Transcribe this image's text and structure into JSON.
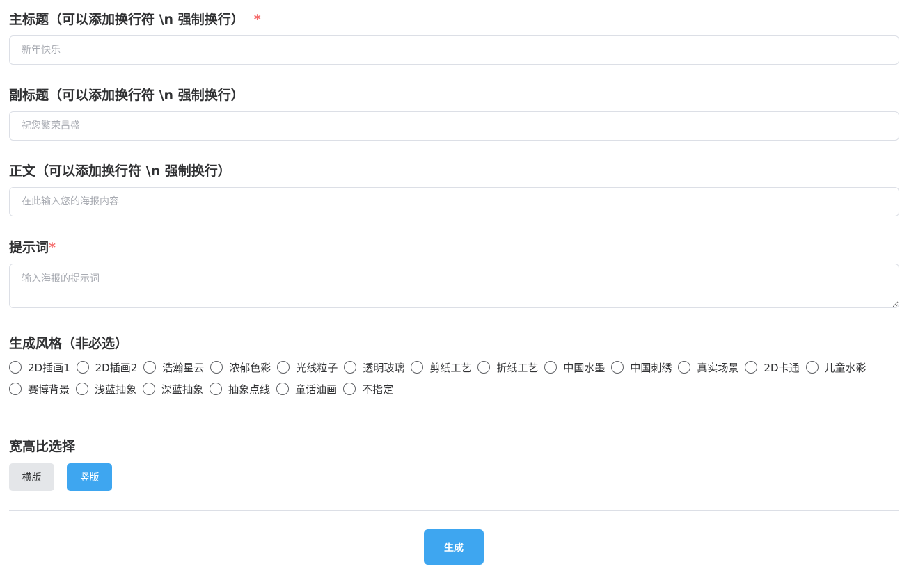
{
  "title_field": {
    "label": "主标题（可以添加换行符 \\n 强制换行）",
    "required_mark": "*",
    "placeholder": "新年快乐"
  },
  "subtitle_field": {
    "label": "副标题（可以添加换行符 \\n 强制换行）",
    "placeholder": "祝您繁荣昌盛"
  },
  "body_field": {
    "label": "正文（可以添加换行符 \\n 强制换行）",
    "placeholder": "在此输入您的海报内容"
  },
  "prompt_field": {
    "label": "提示词",
    "required_mark": "*",
    "placeholder": "输入海报的提示词"
  },
  "style_section": {
    "label": "生成风格（非必选）",
    "row1": [
      "2D插画1",
      "2D插画2",
      "浩瀚星云",
      "浓郁色彩",
      "光线粒子",
      "透明玻璃",
      "剪纸工艺",
      "折纸工艺",
      "中国水墨",
      "中国刺绣",
      "真实场景",
      "2D卡通",
      "儿童水彩"
    ],
    "row2": [
      "赛博背景",
      "浅蓝抽象",
      "深蓝抽象",
      "抽象点线",
      "童话油画",
      "不指定"
    ]
  },
  "ratio_section": {
    "label": "宽高比选择",
    "landscape_label": "横版",
    "portrait_label": "竖版",
    "selected": "竖版"
  },
  "generate_label": "生成",
  "colors": {
    "accent": "#3ea6f0",
    "required": "#f56c6c",
    "text": "#303133",
    "border": "#dcdfe6"
  }
}
